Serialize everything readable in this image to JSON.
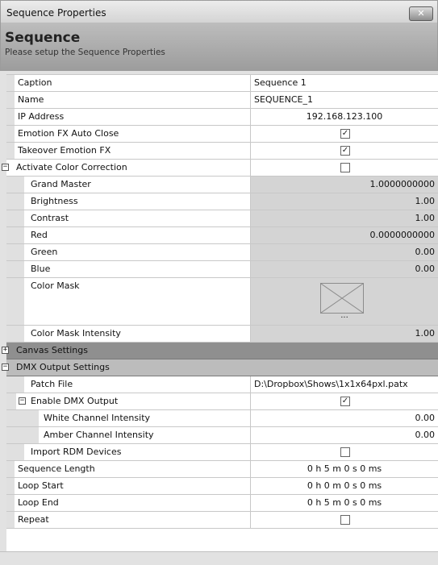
{
  "window": {
    "title": "Sequence Properties",
    "close_icon": "close-icon"
  },
  "header": {
    "title": "Sequence",
    "subtitle": "Please setup the Sequence Properties"
  },
  "colors": {
    "header_bg": "#a8a8a8",
    "category_bg": "#8f8f8f",
    "readonly_bg": "#d4d4d4"
  },
  "rows": [
    {
      "name": "caption",
      "label": "Caption",
      "value": "Sequence 1",
      "align": "left"
    },
    {
      "name": "name",
      "label": "Name",
      "value": "SEQUENCE_1",
      "align": "left"
    },
    {
      "name": "ip-address",
      "label": "IP Address",
      "value": "192.168.123.100",
      "align": "center"
    },
    {
      "name": "emotion-fx-auto-close",
      "label": "Emotion FX Auto Close",
      "checked": true
    },
    {
      "name": "takeover-emotion-fx",
      "label": "Takeover Emotion FX",
      "checked": true
    },
    {
      "name": "activate-color-correction",
      "label": "Activate Color Correction",
      "checked": false,
      "expander": "minus"
    },
    {
      "name": "grand-master",
      "label": "Grand Master",
      "value": "1.0000000000"
    },
    {
      "name": "brightness",
      "label": "Brightness",
      "value": "1.00"
    },
    {
      "name": "contrast",
      "label": "Contrast",
      "value": "1.00"
    },
    {
      "name": "red",
      "label": "Red",
      "value": "0.0000000000"
    },
    {
      "name": "green",
      "label": "Green",
      "value": "0.00"
    },
    {
      "name": "blue",
      "label": "Blue",
      "value": "0.00"
    },
    {
      "name": "color-mask",
      "label": "Color Mask",
      "value": "..."
    },
    {
      "name": "color-mask-intensity",
      "label": "Color Mask Intensity",
      "value": "1.00"
    },
    {
      "name": "canvas-settings",
      "label": "Canvas Settings",
      "expander": "plus"
    },
    {
      "name": "dmx-output-settings",
      "label": "DMX Output Settings",
      "expander": "minus"
    },
    {
      "name": "patch-file",
      "label": "Patch File",
      "value": "D:\\Dropbox\\Shows\\1x1x64pxl.patx",
      "align": "left"
    },
    {
      "name": "enable-dmx-output",
      "label": "Enable DMX Output",
      "checked": true,
      "expander": "minus"
    },
    {
      "name": "white-channel-intensity",
      "label": "White Channel Intensity",
      "value": "0.00"
    },
    {
      "name": "amber-channel-intensity",
      "label": "Amber Channel Intensity",
      "value": "0.00"
    },
    {
      "name": "import-rdm-devices",
      "label": "Import RDM Devices",
      "checked": false
    },
    {
      "name": "sequence-length",
      "label": "Sequence Length",
      "value": "0 h 5 m 0 s 0 ms",
      "align": "center"
    },
    {
      "name": "loop-start",
      "label": "Loop Start",
      "value": "0 h 0 m 0 s 0 ms",
      "align": "center"
    },
    {
      "name": "loop-end",
      "label": "Loop End",
      "value": "0 h 5 m 0 s 0 ms",
      "align": "center"
    },
    {
      "name": "repeat",
      "label": "Repeat",
      "checked": false
    }
  ]
}
